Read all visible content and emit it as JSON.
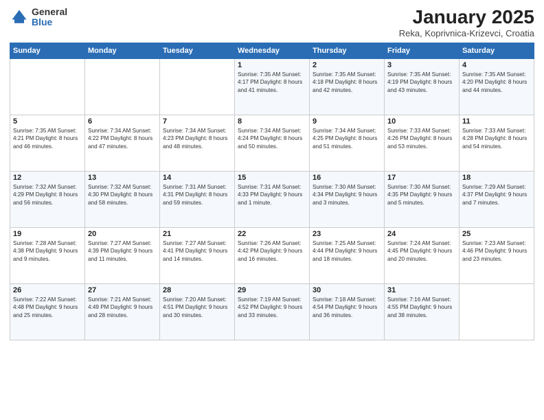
{
  "header": {
    "logo_general": "General",
    "logo_blue": "Blue",
    "title": "January 2025",
    "subtitle": "Reka, Koprivnica-Krizevci, Croatia"
  },
  "days_of_week": [
    "Sunday",
    "Monday",
    "Tuesday",
    "Wednesday",
    "Thursday",
    "Friday",
    "Saturday"
  ],
  "weeks": [
    [
      {
        "day": "",
        "info": ""
      },
      {
        "day": "",
        "info": ""
      },
      {
        "day": "",
        "info": ""
      },
      {
        "day": "1",
        "info": "Sunrise: 7:35 AM\nSunset: 4:17 PM\nDaylight: 8 hours and 41 minutes."
      },
      {
        "day": "2",
        "info": "Sunrise: 7:35 AM\nSunset: 4:18 PM\nDaylight: 8 hours and 42 minutes."
      },
      {
        "day": "3",
        "info": "Sunrise: 7:35 AM\nSunset: 4:19 PM\nDaylight: 8 hours and 43 minutes."
      },
      {
        "day": "4",
        "info": "Sunrise: 7:35 AM\nSunset: 4:20 PM\nDaylight: 8 hours and 44 minutes."
      }
    ],
    [
      {
        "day": "5",
        "info": "Sunrise: 7:35 AM\nSunset: 4:21 PM\nDaylight: 8 hours and 46 minutes."
      },
      {
        "day": "6",
        "info": "Sunrise: 7:34 AM\nSunset: 4:22 PM\nDaylight: 8 hours and 47 minutes."
      },
      {
        "day": "7",
        "info": "Sunrise: 7:34 AM\nSunset: 4:23 PM\nDaylight: 8 hours and 48 minutes."
      },
      {
        "day": "8",
        "info": "Sunrise: 7:34 AM\nSunset: 4:24 PM\nDaylight: 8 hours and 50 minutes."
      },
      {
        "day": "9",
        "info": "Sunrise: 7:34 AM\nSunset: 4:25 PM\nDaylight: 8 hours and 51 minutes."
      },
      {
        "day": "10",
        "info": "Sunrise: 7:33 AM\nSunset: 4:26 PM\nDaylight: 8 hours and 53 minutes."
      },
      {
        "day": "11",
        "info": "Sunrise: 7:33 AM\nSunset: 4:28 PM\nDaylight: 8 hours and 54 minutes."
      }
    ],
    [
      {
        "day": "12",
        "info": "Sunrise: 7:32 AM\nSunset: 4:29 PM\nDaylight: 8 hours and 56 minutes."
      },
      {
        "day": "13",
        "info": "Sunrise: 7:32 AM\nSunset: 4:30 PM\nDaylight: 8 hours and 58 minutes."
      },
      {
        "day": "14",
        "info": "Sunrise: 7:31 AM\nSunset: 4:31 PM\nDaylight: 8 hours and 59 minutes."
      },
      {
        "day": "15",
        "info": "Sunrise: 7:31 AM\nSunset: 4:33 PM\nDaylight: 9 hours and 1 minute."
      },
      {
        "day": "16",
        "info": "Sunrise: 7:30 AM\nSunset: 4:34 PM\nDaylight: 9 hours and 3 minutes."
      },
      {
        "day": "17",
        "info": "Sunrise: 7:30 AM\nSunset: 4:35 PM\nDaylight: 9 hours and 5 minutes."
      },
      {
        "day": "18",
        "info": "Sunrise: 7:29 AM\nSunset: 4:37 PM\nDaylight: 9 hours and 7 minutes."
      }
    ],
    [
      {
        "day": "19",
        "info": "Sunrise: 7:28 AM\nSunset: 4:38 PM\nDaylight: 9 hours and 9 minutes."
      },
      {
        "day": "20",
        "info": "Sunrise: 7:27 AM\nSunset: 4:39 PM\nDaylight: 9 hours and 11 minutes."
      },
      {
        "day": "21",
        "info": "Sunrise: 7:27 AM\nSunset: 4:41 PM\nDaylight: 9 hours and 14 minutes."
      },
      {
        "day": "22",
        "info": "Sunrise: 7:26 AM\nSunset: 4:42 PM\nDaylight: 9 hours and 16 minutes."
      },
      {
        "day": "23",
        "info": "Sunrise: 7:25 AM\nSunset: 4:44 PM\nDaylight: 9 hours and 18 minutes."
      },
      {
        "day": "24",
        "info": "Sunrise: 7:24 AM\nSunset: 4:45 PM\nDaylight: 9 hours and 20 minutes."
      },
      {
        "day": "25",
        "info": "Sunrise: 7:23 AM\nSunset: 4:46 PM\nDaylight: 9 hours and 23 minutes."
      }
    ],
    [
      {
        "day": "26",
        "info": "Sunrise: 7:22 AM\nSunset: 4:48 PM\nDaylight: 9 hours and 25 minutes."
      },
      {
        "day": "27",
        "info": "Sunrise: 7:21 AM\nSunset: 4:49 PM\nDaylight: 9 hours and 28 minutes."
      },
      {
        "day": "28",
        "info": "Sunrise: 7:20 AM\nSunset: 4:51 PM\nDaylight: 9 hours and 30 minutes."
      },
      {
        "day": "29",
        "info": "Sunrise: 7:19 AM\nSunset: 4:52 PM\nDaylight: 9 hours and 33 minutes."
      },
      {
        "day": "30",
        "info": "Sunrise: 7:18 AM\nSunset: 4:54 PM\nDaylight: 9 hours and 36 minutes."
      },
      {
        "day": "31",
        "info": "Sunrise: 7:16 AM\nSunset: 4:55 PM\nDaylight: 9 hours and 38 minutes."
      },
      {
        "day": "",
        "info": ""
      }
    ]
  ]
}
